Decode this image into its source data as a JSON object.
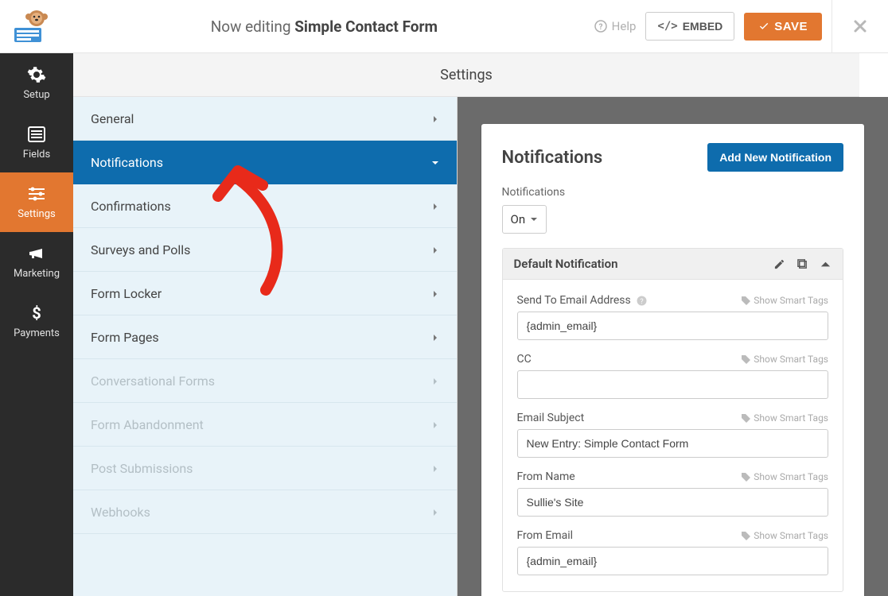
{
  "header": {
    "editing_prefix": "Now editing ",
    "form_name": "Simple Contact Form",
    "help": "Help",
    "embed": "EMBED",
    "save": "SAVE"
  },
  "page_title": "Settings",
  "rail": [
    {
      "label": "Setup"
    },
    {
      "label": "Fields"
    },
    {
      "label": "Settings"
    },
    {
      "label": "Marketing"
    },
    {
      "label": "Payments"
    }
  ],
  "sidebar": [
    {
      "label": "General",
      "state": "normal"
    },
    {
      "label": "Notifications",
      "state": "active"
    },
    {
      "label": "Confirmations",
      "state": "normal"
    },
    {
      "label": "Surveys and Polls",
      "state": "normal"
    },
    {
      "label": "Form Locker",
      "state": "normal"
    },
    {
      "label": "Form Pages",
      "state": "normal"
    },
    {
      "label": "Conversational Forms",
      "state": "disabled"
    },
    {
      "label": "Form Abandonment",
      "state": "disabled"
    },
    {
      "label": "Post Submissions",
      "state": "disabled"
    },
    {
      "label": "Webhooks",
      "state": "disabled"
    }
  ],
  "content": {
    "heading": "Notifications",
    "add_button": "Add New Notification",
    "toggle_label": "Notifications",
    "toggle_value": "On",
    "panel": {
      "title": "Default Notification",
      "smart_tags_label": "Show Smart Tags",
      "fields": {
        "send_to": {
          "label": "Send To Email Address",
          "value": "{admin_email}"
        },
        "cc": {
          "label": "CC",
          "value": ""
        },
        "subject": {
          "label": "Email Subject",
          "value": "New Entry: Simple Contact Form"
        },
        "from_name": {
          "label": "From Name",
          "value": "Sullie's Site"
        },
        "from_email": {
          "label": "From Email",
          "value": "{admin_email}"
        }
      }
    }
  }
}
